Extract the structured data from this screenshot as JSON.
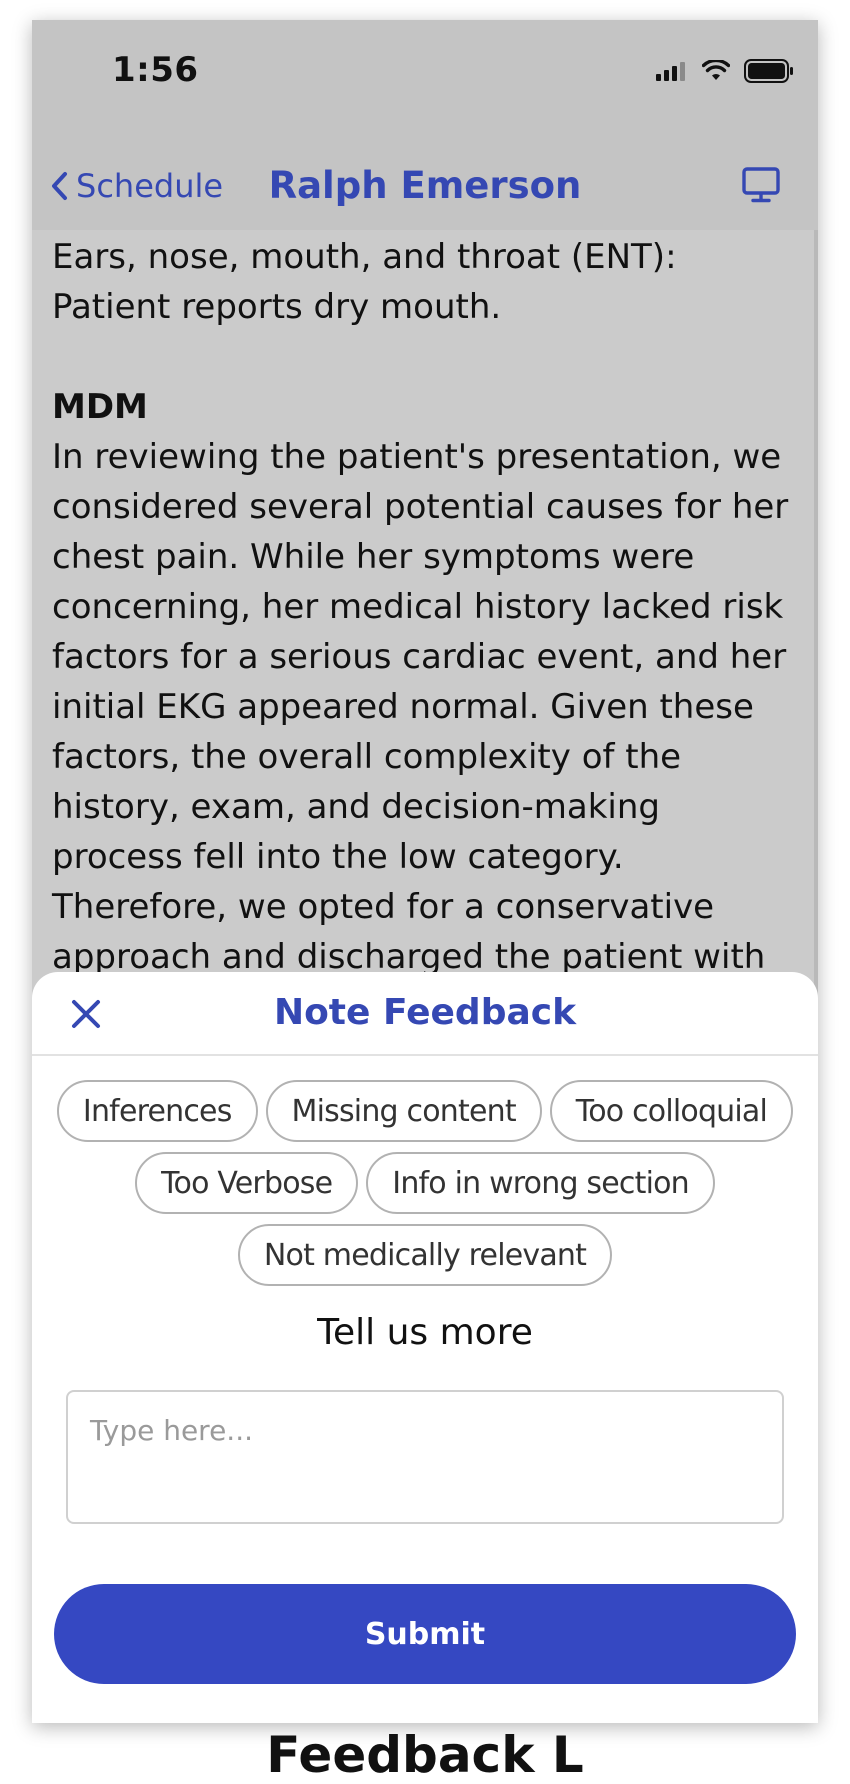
{
  "status_bar": {
    "time": "1:56"
  },
  "nav": {
    "back_label": "Schedule",
    "title": "Ralph Emerson",
    "right_icon": "monitor-icon"
  },
  "note": {
    "ent_text": "Ears, nose, mouth, and throat (ENT): Patient reports dry mouth.",
    "mdm_heading": "MDM",
    "mdm_text": "In reviewing the patient's presentation, we considered several potential causes for her chest pain. While her symptoms were concerning, her medical history lacked risk factors for a serious cardiac event, and her initial EKG appeared normal. Given these factors, the overall complexity of the history, exam, and decision-making process fell into the low category.  Therefore, we opted for a conservative approach and discharged the patient with instructions to"
  },
  "sheet": {
    "title": "Note Feedback",
    "chips": [
      "Inferences",
      "Missing content",
      "Too colloquial",
      "Too Verbose",
      "Info in wrong section",
      "Not medically relevant"
    ],
    "prompt": "Tell us more",
    "input_placeholder": "Type here...",
    "input_value": "",
    "submit_label": "Submit"
  },
  "below_text": "Feedback L",
  "colors": {
    "accent": "#3548c2",
    "title_blue": "#3548b3",
    "overlay": "#cbcbcb"
  }
}
